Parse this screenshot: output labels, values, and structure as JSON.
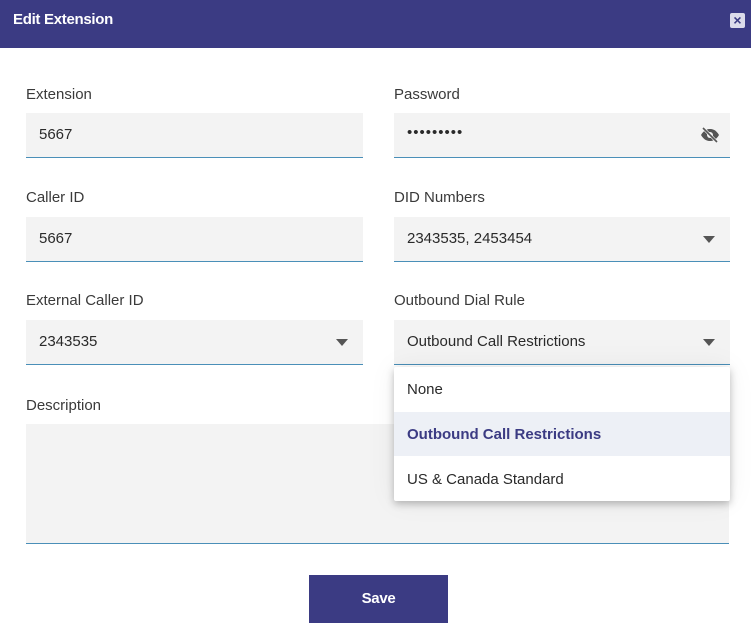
{
  "dialog": {
    "title": "Edit Extension",
    "close_label": "×"
  },
  "form": {
    "extension": {
      "label": "Extension",
      "value": "5667"
    },
    "password": {
      "label": "Password",
      "value": "•••••••••"
    },
    "caller_id": {
      "label": "Caller ID",
      "value": "5667"
    },
    "did_numbers": {
      "label": "DID Numbers",
      "value": "2343535, 2453454"
    },
    "external_caller_id": {
      "label": "External Caller ID",
      "value": "2343535"
    },
    "outbound_dial_rule": {
      "label": "Outbound Dial Rule",
      "value": "Outbound Call Restrictions",
      "options": [
        "None",
        "Outbound Call Restrictions",
        "US & Canada Standard"
      ],
      "selected_index": 1
    },
    "description": {
      "label": "Description",
      "value": ""
    }
  },
  "actions": {
    "save_label": "Save"
  },
  "icons": {
    "password_toggle": "eye-slash-icon",
    "dropdown_caret": "caret-down-icon"
  },
  "colors": {
    "primary": "#3b3b83",
    "field_bg": "#f3f3f3",
    "underline": "#4a8fb8",
    "selected_bg": "#edf0f6"
  }
}
